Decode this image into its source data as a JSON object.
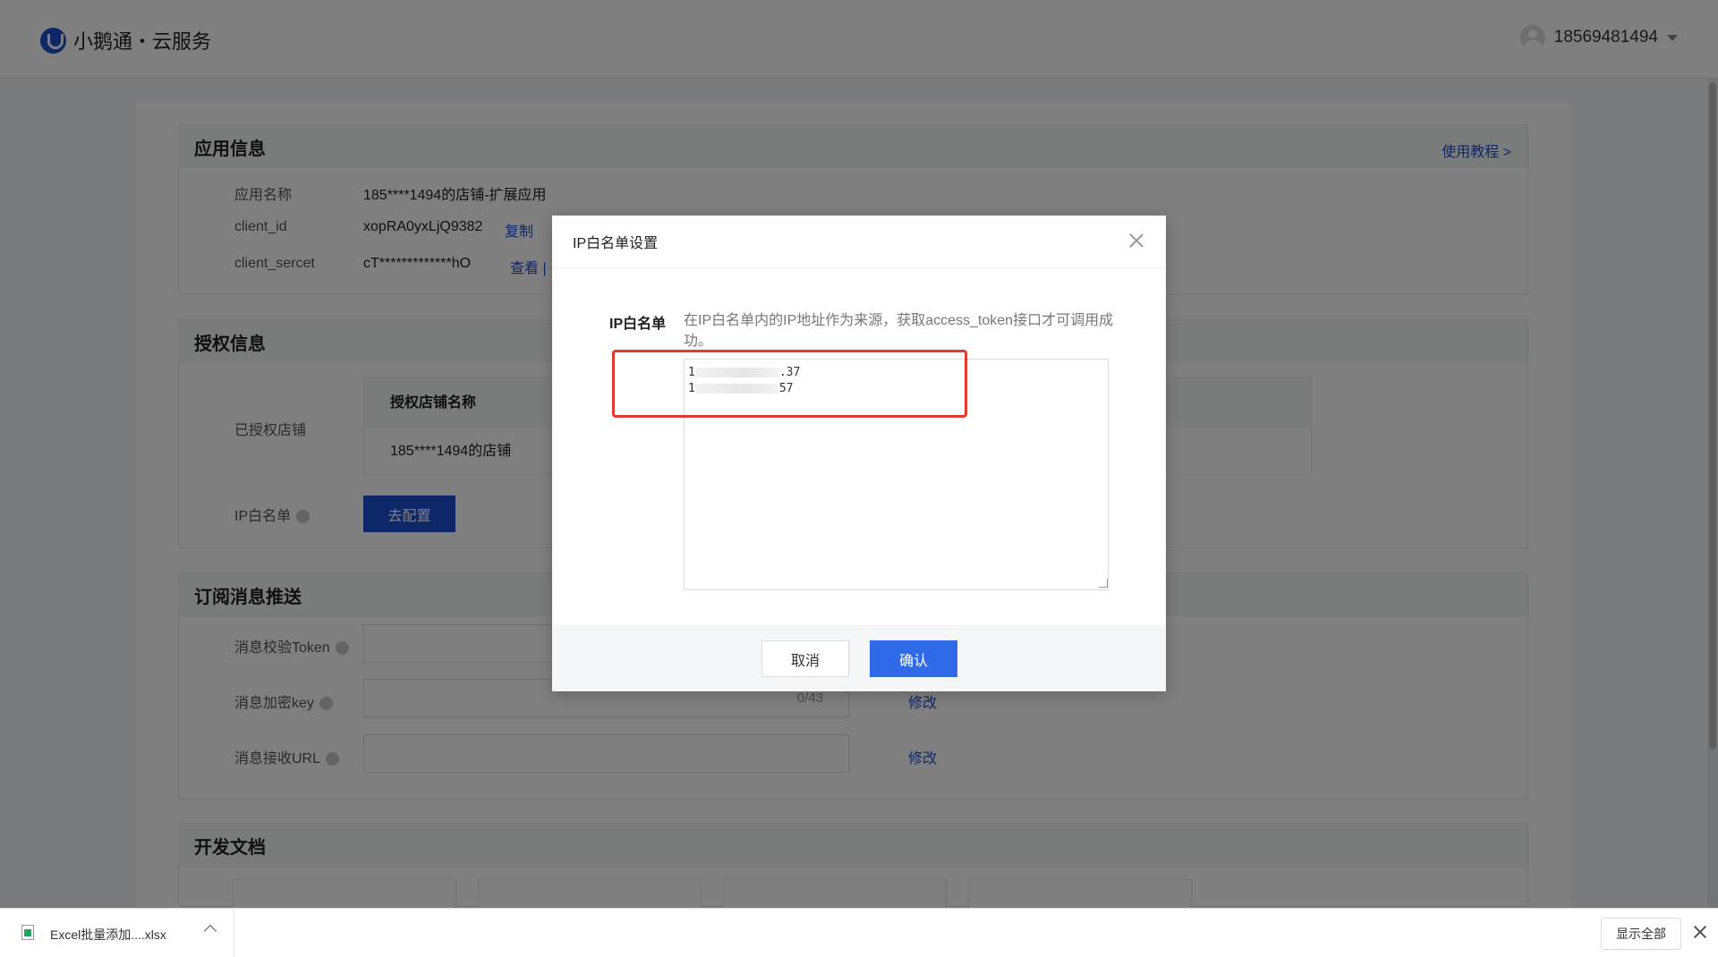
{
  "header": {
    "brand": "小鹅通・云服务",
    "phone": "18569481494"
  },
  "app_info": {
    "title": "应用信息",
    "tutorial_link": "使用教程 >",
    "rows": [
      {
        "label": "应用名称",
        "value": "185****1494的店铺-扩展应用"
      },
      {
        "label": "client_id",
        "value": "xopRA0yxLjQ9382",
        "action": "复制"
      },
      {
        "label": "client_sercet",
        "value": "cT*************hO",
        "action": "查看 |"
      }
    ]
  },
  "auth_info": {
    "title": "授权信息",
    "shops_label": "已授权店铺",
    "table_header": "授权店铺名称",
    "table_row": "185****1494的店铺",
    "ip_label": "IP白名单",
    "configure_button": "去配置"
  },
  "subscribe": {
    "title": "订阅消息推送",
    "rows": [
      {
        "label": "消息校验Token"
      },
      {
        "label": "消息加密key",
        "counter": "0/43",
        "action": "修改"
      },
      {
        "label": "消息接收URL",
        "action": "修改"
      }
    ]
  },
  "docs": {
    "title": "开发文档"
  },
  "modal": {
    "title": "IP白名单设置",
    "field_label": "IP白名单",
    "hint": "在IP白名单内的IP地址作为来源，获取access_token接口才可调用成功。",
    "ip_line1_start": "1",
    "ip_line1_end": ".37",
    "ip_line2_start": "1",
    "ip_line2_end": "57",
    "cancel": "取消",
    "confirm": "确认"
  },
  "download_bar": {
    "filename": "Excel批量添加....xlsx",
    "show_all": "显示全部"
  },
  "colors": {
    "primary": "#1c4fd1",
    "confirm": "#2f6be8",
    "annotation": "#e23b2e"
  }
}
